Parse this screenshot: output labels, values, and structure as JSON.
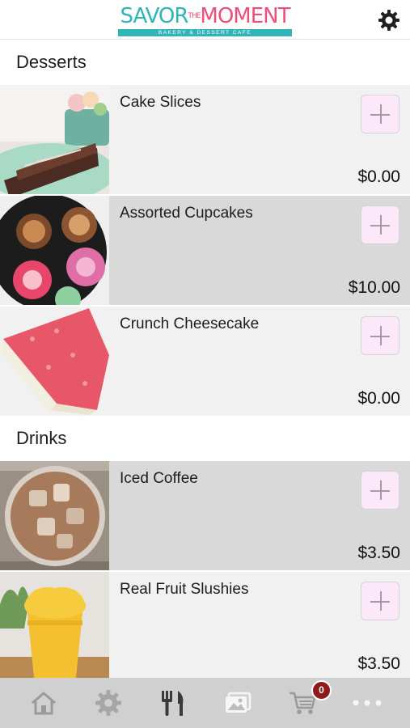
{
  "header": {
    "logo": {
      "word_left": "SAVOR",
      "word_small": "THE",
      "word_right": "MOMENT",
      "tagline": "BAKERY & DESSERT CAFE"
    },
    "settings_icon": "gear-icon"
  },
  "sections": [
    {
      "title": "Desserts",
      "items": [
        {
          "name": "Cake Slices",
          "price": "$0.00"
        },
        {
          "name": "Assorted Cupcakes",
          "price": "$10.00"
        },
        {
          "name": "Crunch Cheesecake",
          "price": "$0.00"
        }
      ]
    },
    {
      "title": "Drinks",
      "items": [
        {
          "name": "Iced Coffee",
          "price": "$3.50"
        },
        {
          "name": "Real Fruit Slushies",
          "price": "$3.50"
        }
      ]
    }
  ],
  "tabbar": {
    "tabs": [
      {
        "icon": "home-icon"
      },
      {
        "icon": "gear-icon"
      },
      {
        "icon": "fork-knife-icon",
        "active": true
      },
      {
        "icon": "photos-icon"
      },
      {
        "icon": "cart-icon"
      },
      {
        "icon": "more-icon"
      }
    ],
    "cart_badge": "0"
  },
  "colors": {
    "logo_teal": "#2fb5b7",
    "logo_pink": "#ee4f79",
    "row_light": "#f1f1f1",
    "row_dark": "#d9d9d9",
    "add_button_bg": "#fbe9fa",
    "tabbar_bg": "#d0d0d0",
    "badge": "#8c1c1c"
  }
}
